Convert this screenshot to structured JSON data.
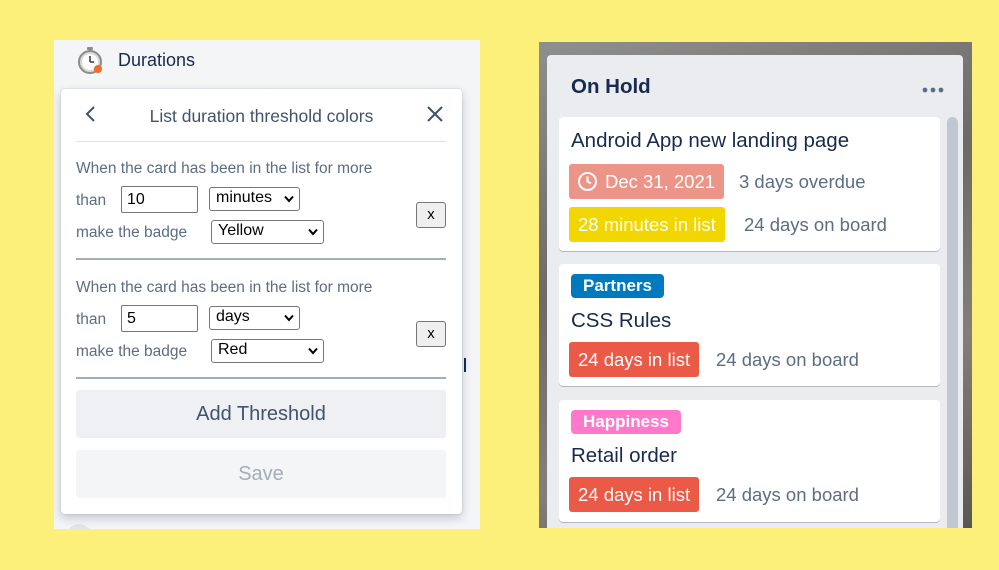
{
  "left_panel": {
    "header_title": "Durations",
    "popup": {
      "title": "List duration threshold colors",
      "thresholds": [
        {
          "line1": "When the card has been in the list for more",
          "than_label": "than",
          "amount": "10",
          "unit": "minutes",
          "make_label": "make the badge",
          "color": "Yellow",
          "remove_label": "x"
        },
        {
          "line1": "When the card has been in the list for more",
          "than_label": "than",
          "amount": "5",
          "unit": "days",
          "make_label": "make the badge",
          "color": "Red",
          "remove_label": "x"
        }
      ],
      "add_button": "Add Threshold",
      "save_button": "Save"
    }
  },
  "list": {
    "title": "On Hold",
    "cards": [
      {
        "title": "Android App new landing page",
        "due_date": "Dec 31, 2021",
        "due_status": "3 days overdue",
        "in_list": "28 minutes in list",
        "on_board": "24 days on board"
      },
      {
        "label": "Partners",
        "title": "CSS Rules",
        "in_list": "24 days in list",
        "on_board": "24 days on board"
      },
      {
        "label": "Happiness",
        "title": "Retail order",
        "in_list": "24 days in list",
        "on_board": "24 days on board"
      }
    ]
  },
  "colors": {
    "page_background": "#fdf07a",
    "yellow_badge": "#f2d600",
    "red_badge": "#eb5a46",
    "overdue_badge": "#ec9488",
    "label_partners": "#0079bf",
    "label_happiness": "#ff78cb"
  }
}
